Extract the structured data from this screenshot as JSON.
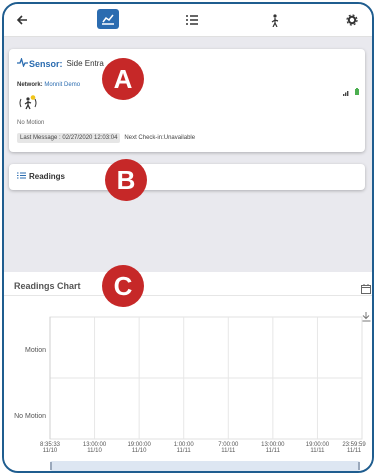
{
  "header": {
    "icons": [
      "back-arrow-icon",
      "chart-icon",
      "list-icon",
      "motion-sensor-icon",
      "gear-icon"
    ]
  },
  "sensor": {
    "title_label": "Sensor:",
    "title_name": "Side Entra",
    "network_label": "Network:",
    "network_value": "Monnit Demo",
    "status": "No Motion",
    "last_message": "Last Message : 02/27/2020 12:03:04",
    "next_checkin": "Next Check-in:Unavailable"
  },
  "readings": {
    "label": "Readings"
  },
  "chart": {
    "title": "Readings Chart"
  },
  "markers": {
    "a": "A",
    "b": "B",
    "c": "C"
  },
  "chart_data": {
    "type": "line",
    "title": "Readings Chart",
    "y_categories": [
      "Motion",
      "No Motion"
    ],
    "x_ticks": [
      {
        "time": "8:35:33",
        "date": "11/10"
      },
      {
        "time": "13:00:00",
        "date": "11/10"
      },
      {
        "time": "19:00:00",
        "date": "11/10"
      },
      {
        "time": "1:00:00",
        "date": "11/11"
      },
      {
        "time": "7:00:00",
        "date": "11/11"
      },
      {
        "time": "13:00:00",
        "date": "11/11"
      },
      {
        "time": "19:00:00",
        "date": "11/11"
      },
      {
        "time": "23:59:59",
        "date": "11/11"
      }
    ],
    "series": [],
    "grid": true
  },
  "colors": {
    "accent": "#2b6cb0",
    "marker": "#c62828",
    "frame": "#1f5d8f"
  }
}
